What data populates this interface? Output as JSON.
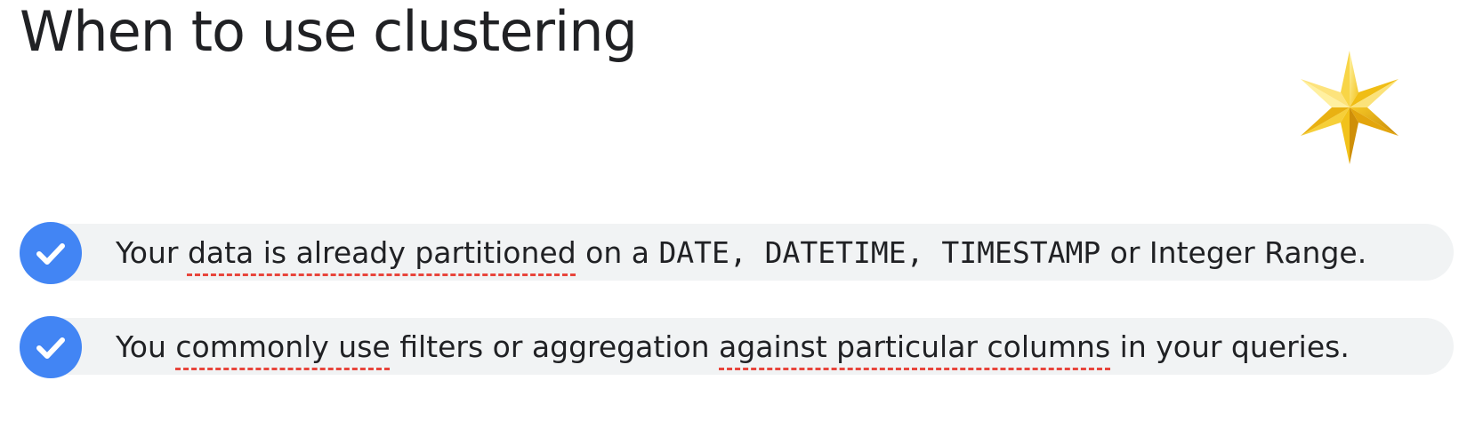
{
  "slide": {
    "title": "When to use clustering",
    "decoration_icon": "gold-star-icon",
    "colors": {
      "check": "#4285f4",
      "row_background": "#f1f3f4",
      "underline": "#e8453c",
      "star": "#f5c518"
    },
    "items": [
      {
        "icon": "checkmark-icon",
        "seg1": "Your ",
        "seg2": "data is already partitioned",
        "seg3": " on a ",
        "code1": "DATE",
        "sep1": ", ",
        "code2": "DATETIME",
        "sep2": ", ",
        "code3": "TIMESTAMP",
        "seg4": " or Integer Range."
      },
      {
        "icon": "checkmark-icon",
        "seg1": "You ",
        "seg2": "commonly use",
        "seg3": " filters or aggregation ",
        "seg4": "against particular columns",
        "seg5": " in your queries."
      }
    ]
  }
}
